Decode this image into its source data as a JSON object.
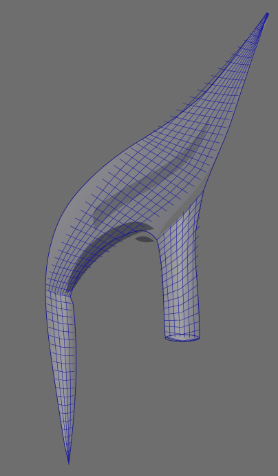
{
  "viewport": {
    "background_color": "#6e6e6e",
    "wireframe_color": "#18188c",
    "surface_light": "#8e8e92",
    "surface_dark": "#3d3d48"
  },
  "model": {
    "display_mode": "wireframe-on-shaded"
  }
}
